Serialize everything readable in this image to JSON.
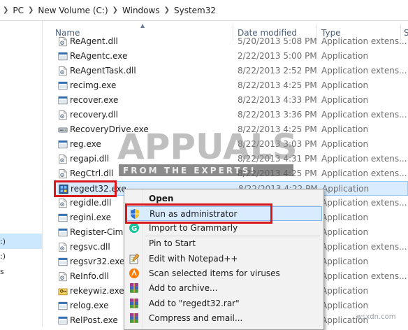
{
  "breadcrumb": [
    "PC",
    "New Volume (C:)",
    "Windows",
    "System32"
  ],
  "nav_fragments": [
    ":)",
    ":)",
    "s"
  ],
  "columns": {
    "name": "Name",
    "date": "Date modified",
    "type": "Type",
    "size": "S"
  },
  "files": [
    {
      "name": "ReAgent.dll",
      "date": "5/20/2013 5:08 PM",
      "type": "Application extens...",
      "icon": "dll-icon"
    },
    {
      "name": "ReAgentc.exe",
      "date": "2/22/2013 5:00 PM",
      "type": "Application",
      "icon": "exe-icon"
    },
    {
      "name": "ReAgentTask.dll",
      "date": "8/22/2013 2:52 PM",
      "type": "Application extens...",
      "icon": "dll-icon"
    },
    {
      "name": "recimg.exe",
      "date": "8/22/2013 4:25 PM",
      "type": "Application",
      "icon": "exe-icon"
    },
    {
      "name": "recover.exe",
      "date": "8/22/2013 4:33 PM",
      "type": "Application",
      "icon": "exe-icon"
    },
    {
      "name": "recovery.dll",
      "date": "8/22/2013 3:36 PM",
      "type": "Application extens...",
      "icon": "dll-icon"
    },
    {
      "name": "RecoveryDrive.exe",
      "date": "8/22/2013 4:25 PM",
      "type": "Application",
      "icon": "drive-icon"
    },
    {
      "name": "reg.exe",
      "date": "8/22/2013 3:03 PM",
      "type": "Application",
      "icon": "exe-icon"
    },
    {
      "name": "regapi.dll",
      "date": "8/22/2013 4:31 PM",
      "type": "Application extens...",
      "icon": "dll-icon"
    },
    {
      "name": "RegCtrl.dll",
      "date": "8/22/2013 4:25 PM",
      "type": "Application extens...",
      "icon": "dll-icon"
    },
    {
      "name": "regedt32.exe",
      "date": "8/22/2013 4:22 PM",
      "type": "Application",
      "icon": "registry-icon",
      "selected": true
    },
    {
      "name": "regidle.dll",
      "date": "",
      "type": "Application extens...",
      "icon": "dll-icon"
    },
    {
      "name": "regini.exe",
      "date": "",
      "type": "Application",
      "icon": "exe-icon"
    },
    {
      "name": "Register-CimP",
      "date": "",
      "type": "Application",
      "icon": "exe-icon"
    },
    {
      "name": "regsvc.dll",
      "date": "",
      "type": "Application extens...",
      "icon": "dll-icon"
    },
    {
      "name": "regsvr32.exe",
      "date": "",
      "type": "Application",
      "icon": "exe-icon"
    },
    {
      "name": "ReInfo.dll",
      "date": "",
      "type": "Application extens...",
      "icon": "dll-icon"
    },
    {
      "name": "rekeywiz.exe",
      "date": "",
      "type": "Application",
      "icon": "keys-icon"
    },
    {
      "name": "relog.exe",
      "date": "",
      "type": "Application",
      "icon": "exe-icon"
    },
    {
      "name": "RelPost.exe",
      "date": "",
      "type": "Application",
      "icon": "exe-icon"
    }
  ],
  "context_menu": [
    {
      "label": "Open",
      "bold": true,
      "icon": ""
    },
    {
      "label": "Run as administrator",
      "icon": "uac-shield-icon",
      "highlighted": true
    },
    {
      "label": "Import to Grammarly",
      "icon": "grammarly-icon"
    },
    {
      "label": "Pin to Start",
      "icon": ""
    },
    {
      "label": "Edit with Notepad++",
      "icon": "notepadpp-icon"
    },
    {
      "label": "Scan selected items for viruses",
      "icon": "avast-icon"
    },
    {
      "label": "Add to archive...",
      "icon": "winrar-icon"
    },
    {
      "label": "Add to \"regedt32.rar\"",
      "icon": "winrar-icon"
    },
    {
      "label": "Compress and email...",
      "icon": "winrar-icon"
    }
  ],
  "watermark": {
    "big": "APPUALS",
    "small": "FROM THE EXPERTS!"
  },
  "corner_text": "wsxdn.com",
  "colors": {
    "accent": "#cce8ff",
    "annotation": "#d7191c"
  }
}
